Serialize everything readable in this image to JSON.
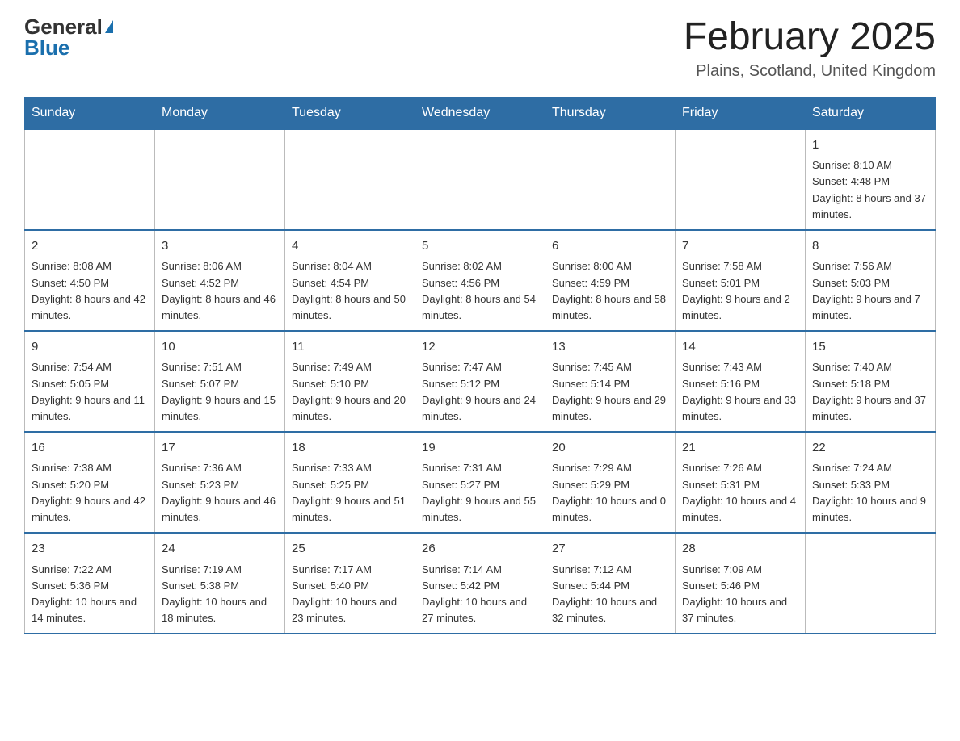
{
  "logo": {
    "general": "General",
    "blue": "Blue"
  },
  "title": "February 2025",
  "subtitle": "Plains, Scotland, United Kingdom",
  "days_of_week": [
    "Sunday",
    "Monday",
    "Tuesday",
    "Wednesday",
    "Thursday",
    "Friday",
    "Saturday"
  ],
  "weeks": [
    [
      {
        "day": "",
        "info": ""
      },
      {
        "day": "",
        "info": ""
      },
      {
        "day": "",
        "info": ""
      },
      {
        "day": "",
        "info": ""
      },
      {
        "day": "",
        "info": ""
      },
      {
        "day": "",
        "info": ""
      },
      {
        "day": "1",
        "info": "Sunrise: 8:10 AM\nSunset: 4:48 PM\nDaylight: 8 hours and 37 minutes."
      }
    ],
    [
      {
        "day": "2",
        "info": "Sunrise: 8:08 AM\nSunset: 4:50 PM\nDaylight: 8 hours and 42 minutes."
      },
      {
        "day": "3",
        "info": "Sunrise: 8:06 AM\nSunset: 4:52 PM\nDaylight: 8 hours and 46 minutes."
      },
      {
        "day": "4",
        "info": "Sunrise: 8:04 AM\nSunset: 4:54 PM\nDaylight: 8 hours and 50 minutes."
      },
      {
        "day": "5",
        "info": "Sunrise: 8:02 AM\nSunset: 4:56 PM\nDaylight: 8 hours and 54 minutes."
      },
      {
        "day": "6",
        "info": "Sunrise: 8:00 AM\nSunset: 4:59 PM\nDaylight: 8 hours and 58 minutes."
      },
      {
        "day": "7",
        "info": "Sunrise: 7:58 AM\nSunset: 5:01 PM\nDaylight: 9 hours and 2 minutes."
      },
      {
        "day": "8",
        "info": "Sunrise: 7:56 AM\nSunset: 5:03 PM\nDaylight: 9 hours and 7 minutes."
      }
    ],
    [
      {
        "day": "9",
        "info": "Sunrise: 7:54 AM\nSunset: 5:05 PM\nDaylight: 9 hours and 11 minutes."
      },
      {
        "day": "10",
        "info": "Sunrise: 7:51 AM\nSunset: 5:07 PM\nDaylight: 9 hours and 15 minutes."
      },
      {
        "day": "11",
        "info": "Sunrise: 7:49 AM\nSunset: 5:10 PM\nDaylight: 9 hours and 20 minutes."
      },
      {
        "day": "12",
        "info": "Sunrise: 7:47 AM\nSunset: 5:12 PM\nDaylight: 9 hours and 24 minutes."
      },
      {
        "day": "13",
        "info": "Sunrise: 7:45 AM\nSunset: 5:14 PM\nDaylight: 9 hours and 29 minutes."
      },
      {
        "day": "14",
        "info": "Sunrise: 7:43 AM\nSunset: 5:16 PM\nDaylight: 9 hours and 33 minutes."
      },
      {
        "day": "15",
        "info": "Sunrise: 7:40 AM\nSunset: 5:18 PM\nDaylight: 9 hours and 37 minutes."
      }
    ],
    [
      {
        "day": "16",
        "info": "Sunrise: 7:38 AM\nSunset: 5:20 PM\nDaylight: 9 hours and 42 minutes."
      },
      {
        "day": "17",
        "info": "Sunrise: 7:36 AM\nSunset: 5:23 PM\nDaylight: 9 hours and 46 minutes."
      },
      {
        "day": "18",
        "info": "Sunrise: 7:33 AM\nSunset: 5:25 PM\nDaylight: 9 hours and 51 minutes."
      },
      {
        "day": "19",
        "info": "Sunrise: 7:31 AM\nSunset: 5:27 PM\nDaylight: 9 hours and 55 minutes."
      },
      {
        "day": "20",
        "info": "Sunrise: 7:29 AM\nSunset: 5:29 PM\nDaylight: 10 hours and 0 minutes."
      },
      {
        "day": "21",
        "info": "Sunrise: 7:26 AM\nSunset: 5:31 PM\nDaylight: 10 hours and 4 minutes."
      },
      {
        "day": "22",
        "info": "Sunrise: 7:24 AM\nSunset: 5:33 PM\nDaylight: 10 hours and 9 minutes."
      }
    ],
    [
      {
        "day": "23",
        "info": "Sunrise: 7:22 AM\nSunset: 5:36 PM\nDaylight: 10 hours and 14 minutes."
      },
      {
        "day": "24",
        "info": "Sunrise: 7:19 AM\nSunset: 5:38 PM\nDaylight: 10 hours and 18 minutes."
      },
      {
        "day": "25",
        "info": "Sunrise: 7:17 AM\nSunset: 5:40 PM\nDaylight: 10 hours and 23 minutes."
      },
      {
        "day": "26",
        "info": "Sunrise: 7:14 AM\nSunset: 5:42 PM\nDaylight: 10 hours and 27 minutes."
      },
      {
        "day": "27",
        "info": "Sunrise: 7:12 AM\nSunset: 5:44 PM\nDaylight: 10 hours and 32 minutes."
      },
      {
        "day": "28",
        "info": "Sunrise: 7:09 AM\nSunset: 5:46 PM\nDaylight: 10 hours and 37 minutes."
      },
      {
        "day": "",
        "info": ""
      }
    ]
  ]
}
